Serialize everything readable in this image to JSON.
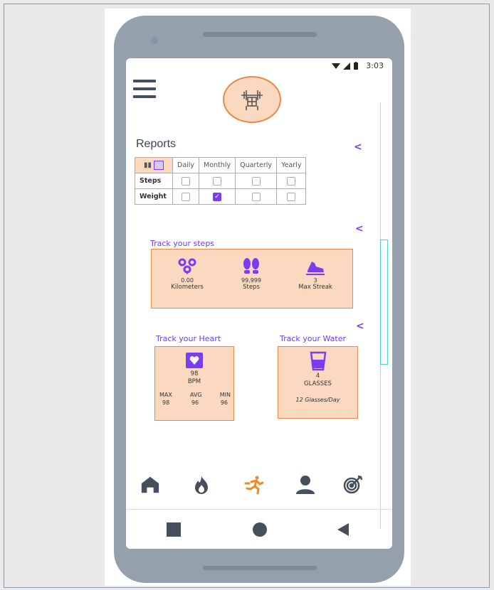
{
  "status_bar": {
    "time": "3:03",
    "icons": [
      "wifi-icon",
      "signal-icon",
      "battery-icon"
    ]
  },
  "header": {
    "logo_icon": "barbell-icon",
    "menu_icon": "hamburger-icon"
  },
  "reports": {
    "title": "Reports",
    "share_icon": "share-icon",
    "columns": [
      "Daily",
      "Monthly",
      "Quarterly",
      "Yearly"
    ],
    "rows": [
      {
        "label": "Steps",
        "checked": [
          false,
          false,
          false,
          false
        ]
      },
      {
        "label": "Weight",
        "checked": [
          false,
          true,
          false,
          false
        ]
      }
    ]
  },
  "steps_card": {
    "title": "Track your steps",
    "stats": [
      {
        "icon": "location-pins-icon",
        "value": "0.00",
        "label": "Kilometers"
      },
      {
        "icon": "footprints-icon",
        "value": "99,999",
        "label": "Steps"
      },
      {
        "icon": "shoe-icon",
        "value": "3",
        "label": "Max Streak"
      }
    ]
  },
  "heart_card": {
    "title": "Track your Heart",
    "icon": "heart-icon",
    "value": "98",
    "unit": "BPM",
    "labels": [
      "MAX",
      "AVG",
      "MIN"
    ],
    "values": [
      "98",
      "96",
      "96"
    ]
  },
  "water_card": {
    "title": "Track your Water",
    "icon": "glass-icon",
    "value": "4",
    "unit": "GLASSES",
    "goal": "12 Glasses/Day"
  },
  "bottom_nav": [
    "home-icon",
    "fire-icon",
    "running-icon",
    "person-icon",
    "target-icon"
  ],
  "system_nav": [
    "square-button",
    "circle-button",
    "back-button"
  ],
  "colors": {
    "accent": "#7a3df2",
    "card_bg": "#fad9c0",
    "card_border": "#e88a4a",
    "active_nav": "#f08a24",
    "nav_icon": "#45505c"
  }
}
